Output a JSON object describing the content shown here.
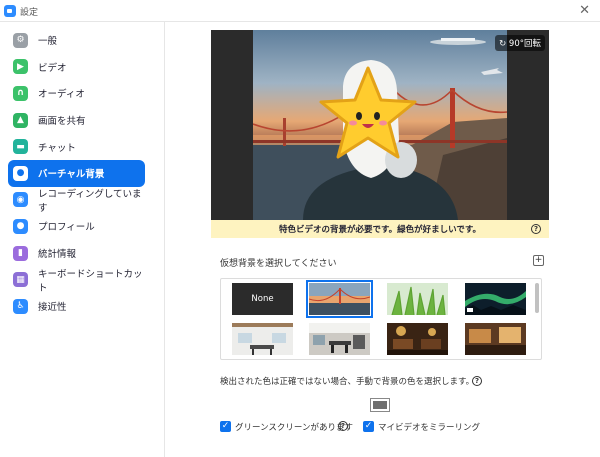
{
  "window": {
    "title": "設定",
    "close_glyph": "✕"
  },
  "sidebar": {
    "items": [
      {
        "label": "一般",
        "icon": "gear-icon",
        "color": "#9aa0a6",
        "glyph": "⚙"
      },
      {
        "label": "ビデオ",
        "icon": "video-camera-icon",
        "color": "#3cc26a",
        "glyph": "▶"
      },
      {
        "label": "オーディオ",
        "icon": "headphones-icon",
        "color": "#3cc26a",
        "glyph": "∩"
      },
      {
        "label": "画面を共有",
        "icon": "share-screen-icon",
        "color": "#2fb463",
        "glyph": "▲"
      },
      {
        "label": "チャット",
        "icon": "chat-bubble-icon",
        "color": "#22b39b",
        "glyph": "▬"
      },
      {
        "label": "バーチャル背景",
        "icon": "person-background-icon",
        "color": "#0e72ed",
        "glyph": "●",
        "active": true
      },
      {
        "label": "レコーディングしています",
        "icon": "record-icon",
        "color": "#2d8cff",
        "glyph": "◉"
      },
      {
        "label": "プロフィール",
        "icon": "profile-icon",
        "color": "#2d8cff",
        "glyph": "●"
      },
      {
        "label": "統計情報",
        "icon": "statistics-icon",
        "color": "#9b6cdd",
        "glyph": "▮"
      },
      {
        "label": "キーボードショートカット",
        "icon": "keyboard-icon",
        "color": "#8c6fd6",
        "glyph": "▦"
      },
      {
        "label": "接近性",
        "icon": "accessibility-icon",
        "color": "#2d8cff",
        "glyph": "♿"
      }
    ]
  },
  "main": {
    "rotate_label": "90°回転",
    "warning": "特色ビデオの背景が必要です。緑色が好ましいです。",
    "choose_label": "仮想背景を選択してください",
    "add_glyph": "+",
    "help_glyph": "?",
    "thumbnails": [
      {
        "label": "None"
      },
      {
        "name": "golden-gate-thumbnail",
        "selected": true
      },
      {
        "name": "grass-thumbnail"
      },
      {
        "name": "aurora-thumbnail"
      },
      {
        "name": "office-room-thumbnail"
      },
      {
        "name": "dining-room-thumbnail"
      },
      {
        "name": "restaurant-thumbnail"
      },
      {
        "name": "lounge-thumbnail"
      }
    ],
    "detect_text": "検出された色は正確ではない場合、手動で背景の色を選択します。",
    "swatch_color": "#6f6f6f",
    "green_screen_label": "グリーンスクリーンがあります",
    "mirror_label": "マイビデオをミラーリング",
    "check_glyph": "✓"
  }
}
